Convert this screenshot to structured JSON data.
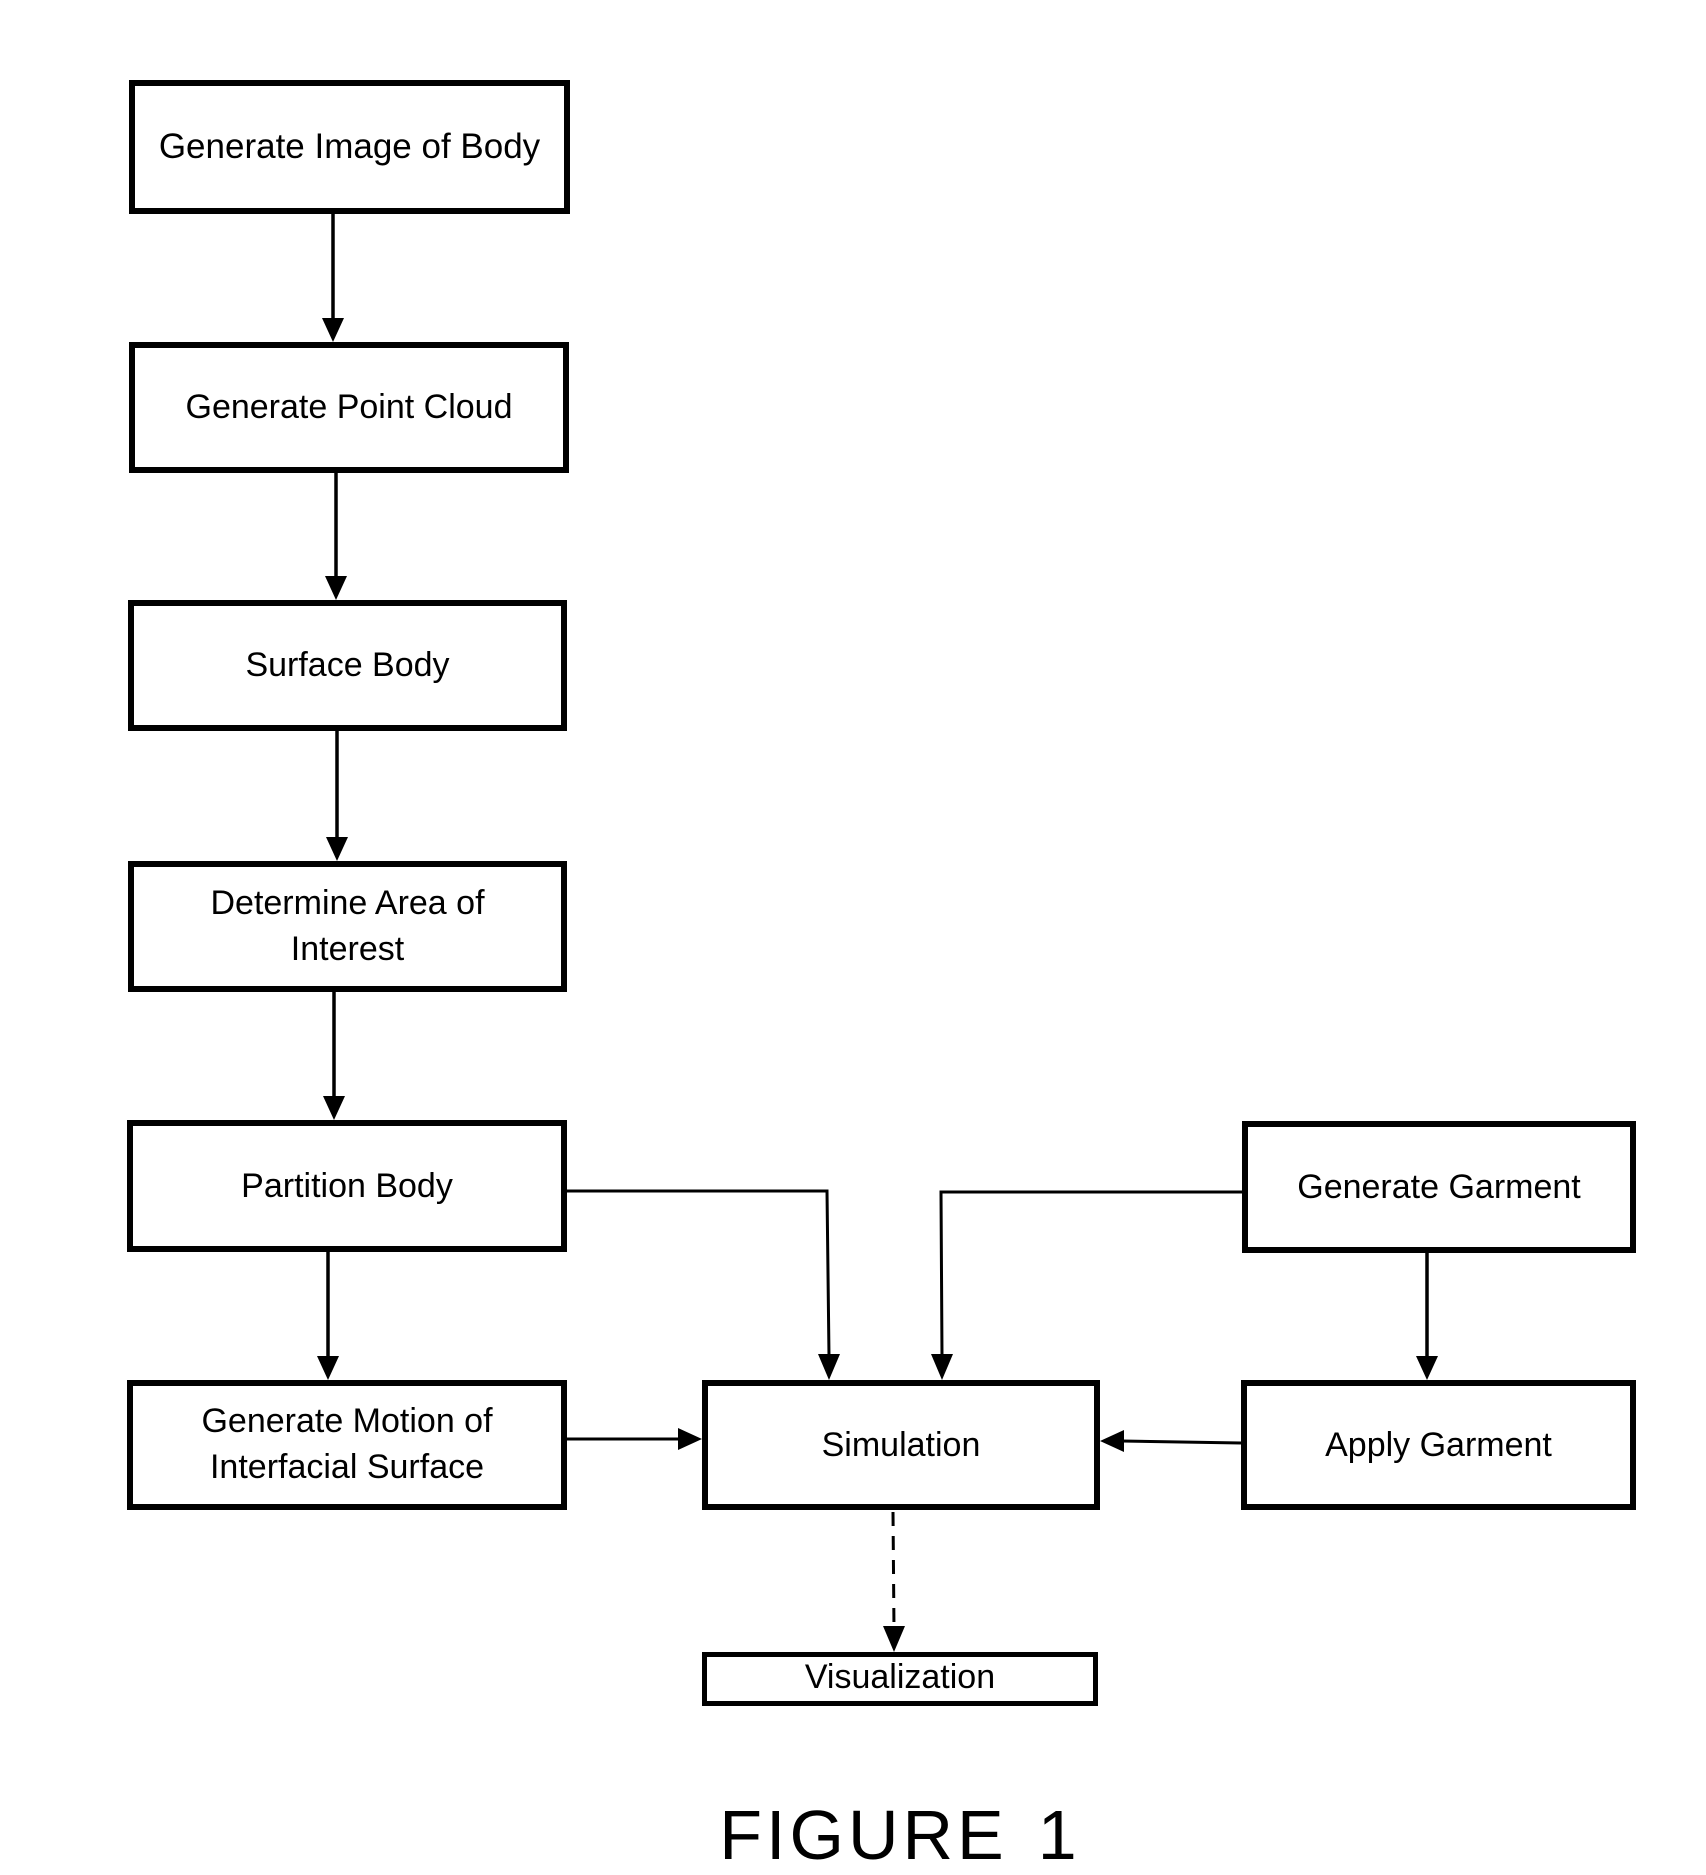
{
  "figure": {
    "label_word": "FIGURE",
    "label_number": "1"
  },
  "nodes": {
    "generate_image": "Generate Image of Body",
    "point_cloud": "Generate Point Cloud",
    "surface_body": "Surface Body",
    "area_of_interest": "Determine Area of\nInterest",
    "partition_body": "Partition Body",
    "motion_surface": "Generate Motion of\nInterfacial Surface",
    "simulation": "Simulation",
    "visualization": "Visualization",
    "generate_garment": "Generate Garment",
    "apply_garment": "Apply Garment"
  },
  "edges": [
    {
      "from": "generate_image",
      "to": "point_cloud",
      "style": "solid"
    },
    {
      "from": "point_cloud",
      "to": "surface_body",
      "style": "solid"
    },
    {
      "from": "surface_body",
      "to": "area_of_interest",
      "style": "solid"
    },
    {
      "from": "area_of_interest",
      "to": "partition_body",
      "style": "solid"
    },
    {
      "from": "partition_body",
      "to": "motion_surface",
      "style": "solid"
    },
    {
      "from": "partition_body",
      "to": "simulation",
      "style": "solid"
    },
    {
      "from": "generate_garment",
      "to": "simulation",
      "style": "solid"
    },
    {
      "from": "generate_garment",
      "to": "apply_garment",
      "style": "solid"
    },
    {
      "from": "motion_surface",
      "to": "simulation",
      "style": "solid"
    },
    {
      "from": "apply_garment",
      "to": "simulation",
      "style": "solid"
    },
    {
      "from": "simulation",
      "to": "visualization",
      "style": "dashed"
    }
  ]
}
